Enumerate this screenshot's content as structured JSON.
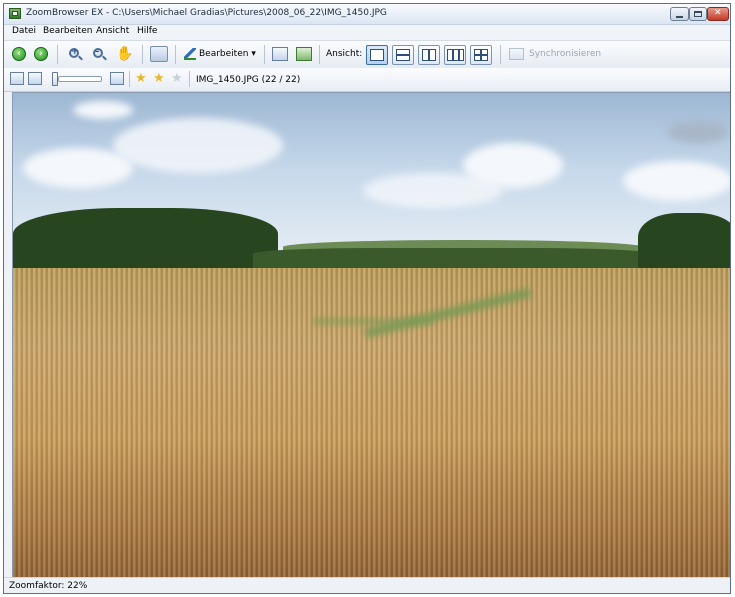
{
  "window": {
    "title": "ZoomBrowser EX - C:\\Users\\Michael Gradias\\Pictures\\2008_06_22\\IMG_1450.JPG"
  },
  "menu": {
    "items": [
      "Datei",
      "Bearbeiten",
      "Ansicht",
      "Hilfe"
    ]
  },
  "toolbar": {
    "back_icon": "arrow-left-icon",
    "forward_icon": "arrow-right-icon",
    "edit_label": "Bearbeiten",
    "view_label": "Ansicht:",
    "sync_label": "Synchronisieren"
  },
  "toolbar2": {
    "file_info": "IMG_1450.JPG (22 / 22)",
    "rating_stars": 3
  },
  "image": {
    "description_icon": "photo-wheat-field"
  },
  "status": {
    "zoom_text": "Zoomfaktor: 22%"
  },
  "colors": {
    "accent": "#3a6ea5",
    "titlebar": "#dbe6f3",
    "nav_green": "#1f8f1f"
  }
}
